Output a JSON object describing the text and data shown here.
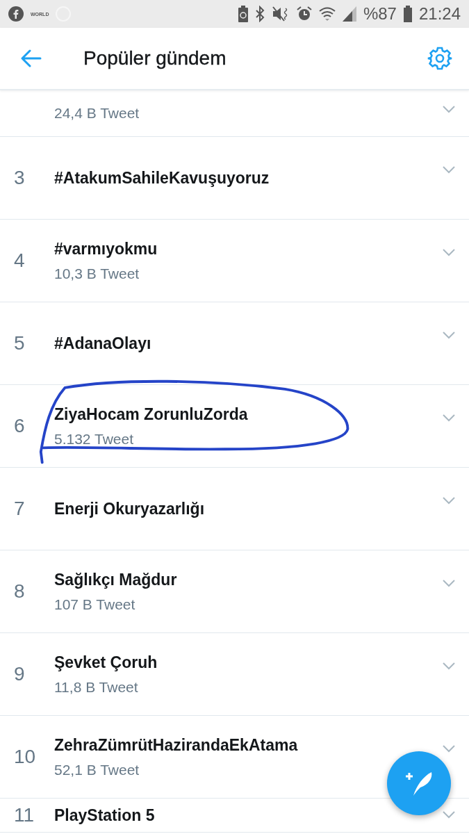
{
  "status_bar": {
    "app_label": "WORLD",
    "battery_percent": "%87",
    "time": "21:24"
  },
  "header": {
    "title": "Popüler gündem"
  },
  "trends": [
    {
      "count": "24,4 B Tweet",
      "highlighted": false
    },
    {
      "rank": "3",
      "title": "#AtakumSahileKavuşuyoruz",
      "highlighted": false
    },
    {
      "rank": "4",
      "title": "#varmıyokmu",
      "count": "10,3 B Tweet",
      "highlighted": false
    },
    {
      "rank": "5",
      "title": "#AdanaOlayı",
      "highlighted": false
    },
    {
      "rank": "6",
      "title": "ZiyaHocam ZorunluZorda",
      "count": "5.132 Tweet",
      "highlighted": true
    },
    {
      "rank": "7",
      "title": "Enerji Okuryazarlığı",
      "highlighted": false
    },
    {
      "rank": "8",
      "title": "Sağlıkçı Mağdur",
      "count": "107 B Tweet",
      "highlighted": false
    },
    {
      "rank": "9",
      "title": "Şevket Çoruh",
      "count": "11,8 B Tweet",
      "highlighted": false
    },
    {
      "rank": "10",
      "title": "ZehraZümrütHazirandaEkAtama",
      "count": "52,1 B Tweet",
      "highlighted": false
    },
    {
      "rank": "11",
      "title": "PlayStation 5",
      "highlighted": false
    }
  ]
}
